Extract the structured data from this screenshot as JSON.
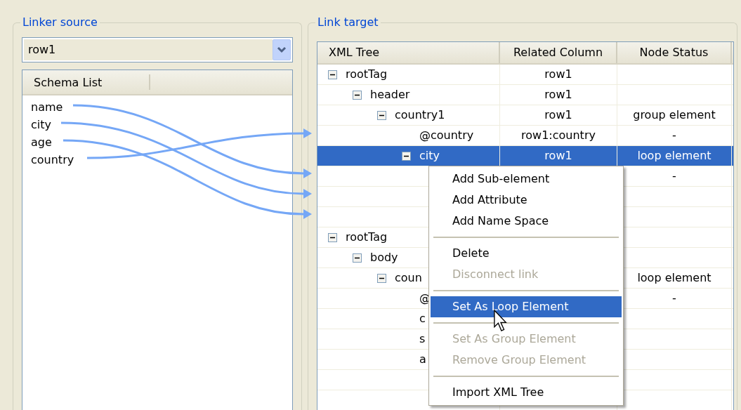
{
  "linker_source": {
    "title": "Linker source",
    "combo": {
      "value": "row1"
    },
    "schema_list": {
      "header": "Schema List",
      "items": [
        "name",
        "city",
        "age",
        "country"
      ]
    }
  },
  "link_target": {
    "title": "Link target",
    "columns": [
      "XML Tree",
      "Related Column",
      "Node Status"
    ],
    "tree": [
      {
        "kind": "node",
        "name": "rootTag",
        "related_column": "row1",
        "expanded": true,
        "selected": false,
        "children": [
          {
            "kind": "node",
            "name": "header",
            "related_column": "row1",
            "expanded": true,
            "selected": false,
            "children": [
              {
                "kind": "node",
                "name": "country1",
                "related_column": "row1",
                "node_status": "group element",
                "expanded": true,
                "selected": false,
                "children": [
                  {
                    "kind": "node",
                    "name": "@country",
                    "related_column": "row1:country",
                    "node_status": "-",
                    "expanded": false,
                    "selected": false
                  },
                  {
                    "kind": "node",
                    "name": "city",
                    "related_column": "row1",
                    "node_status": "loop element",
                    "expanded": true,
                    "selected": true,
                    "children": [
                      {
                        "kind": "node",
                        "node_status": "-",
                        "expanded": false,
                        "selected": false
                      }
                    ]
                  }
                ]
              }
            ]
          }
        ]
      },
      {
        "kind": "blank"
      },
      {
        "kind": "blank"
      },
      {
        "kind": "node",
        "name": "rootTag",
        "expanded": true,
        "selected": false,
        "children": [
          {
            "kind": "node",
            "name": "body",
            "expanded": true,
            "selected": false,
            "children": [
              {
                "kind": "node",
                "name": "coun",
                "node_status": "loop element",
                "expanded": true,
                "selected": false,
                "children": [
                  {
                    "kind": "node",
                    "name": "@",
                    "node_status": "-",
                    "expanded": false,
                    "selected": false
                  },
                  {
                    "kind": "node",
                    "name": "c",
                    "expanded": false,
                    "selected": false
                  },
                  {
                    "kind": "node",
                    "name": "s",
                    "expanded": false,
                    "selected": false
                  },
                  {
                    "kind": "node",
                    "name": "a",
                    "expanded": false,
                    "selected": false
                  }
                ]
              }
            ]
          }
        ]
      }
    ]
  },
  "context_menu": [
    {
      "kind": "item",
      "label": "Add Sub-element",
      "disabled": false,
      "selected": false
    },
    {
      "kind": "item",
      "label": "Add Attribute",
      "disabled": false,
      "selected": false
    },
    {
      "kind": "item",
      "label": "Add Name Space",
      "disabled": false,
      "selected": false
    },
    {
      "kind": "separator"
    },
    {
      "kind": "item",
      "label": "Delete",
      "disabled": false,
      "selected": false
    },
    {
      "kind": "item",
      "label": "Disconnect link",
      "disabled": true,
      "selected": false
    },
    {
      "kind": "separator"
    },
    {
      "kind": "item",
      "label": "Set As Loop Element",
      "disabled": false,
      "selected": true
    },
    {
      "kind": "separator"
    },
    {
      "kind": "item",
      "label": "Set As Group Element",
      "disabled": true,
      "selected": false
    },
    {
      "kind": "item",
      "label": "Remove Group Element",
      "disabled": true,
      "selected": false
    },
    {
      "kind": "separator"
    },
    {
      "kind": "item",
      "label": "Import XML Tree",
      "disabled": false,
      "selected": false
    }
  ]
}
